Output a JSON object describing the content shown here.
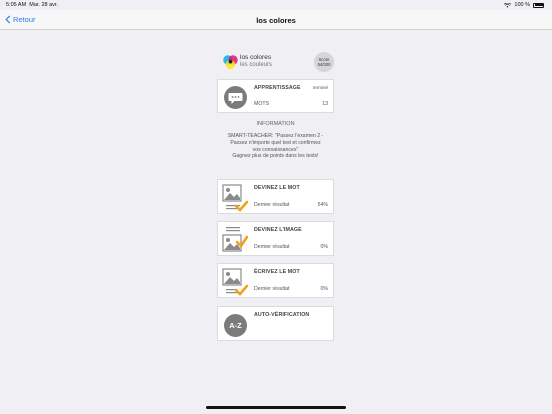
{
  "status": {
    "time": "5:05 AM",
    "date": "Mar. 28 avr.",
    "battery": "100 %"
  },
  "nav": {
    "back_label": "Retour",
    "title": "los colores"
  },
  "header": {
    "title": "los colores",
    "subtitle": "les couleurs",
    "score_label": "Score",
    "score_value": "54/300"
  },
  "learning": {
    "title": "APPRENTISSAGE",
    "status": "terminé",
    "sub_label": "MOTS",
    "sub_value": "13"
  },
  "info": {
    "heading": "INFORMATION",
    "lines": [
      "SMART-TEACHER: \"Passez l'examen 2 -",
      "Passez n'importe quel test et confirmez",
      "vos connaissances\"",
      "Gagnez plus de points dans les tests!"
    ]
  },
  "tests": [
    {
      "title": "DEVINEZ LE MOT",
      "label": "Dernier résultat",
      "value": "54%"
    },
    {
      "title": "DEVINEZ L'IMAGE",
      "label": "Dernier résultat",
      "value": "0%"
    },
    {
      "title": "ÉCRIVEZ LE MOT",
      "label": "Dernier résultat",
      "value": "0%"
    }
  ],
  "auto": {
    "title": "AUTO-VÉRIFICATION",
    "badge": "A-Z"
  },
  "colors": {
    "accent": "#2f7bf6",
    "icon_gray": "#7b7b7b",
    "check_orange": "#f2a21b",
    "background": "#efeff4"
  }
}
